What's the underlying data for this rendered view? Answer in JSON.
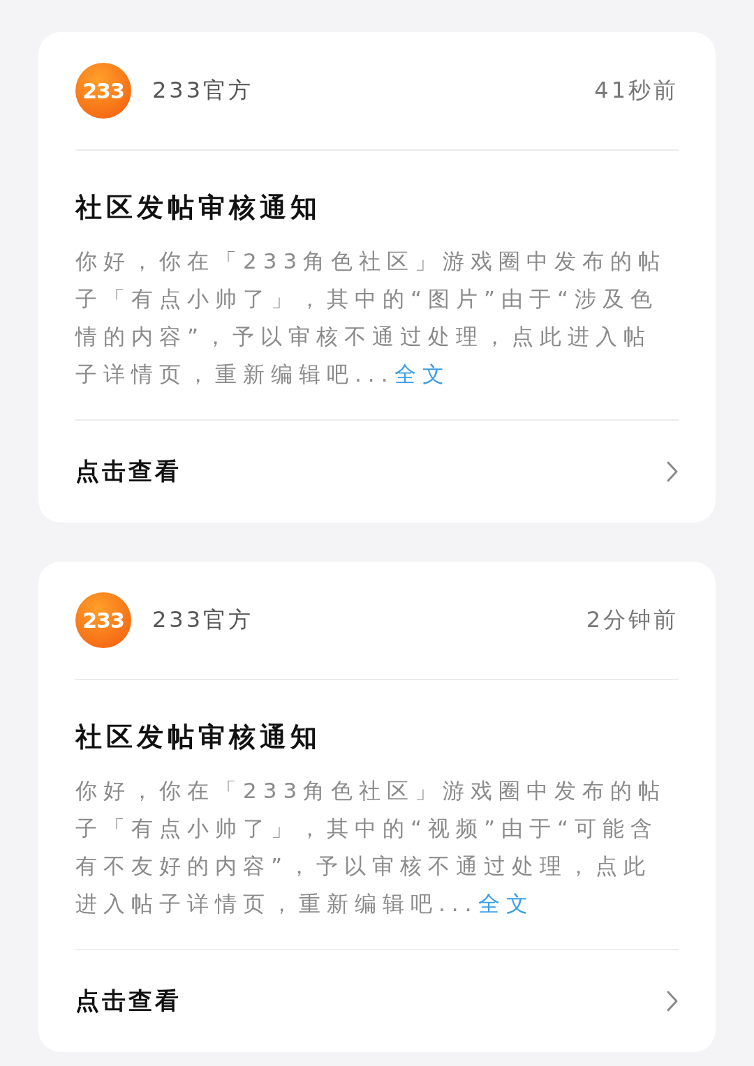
{
  "notifications": [
    {
      "sender": {
        "avatar_text": "233",
        "name": "233官方"
      },
      "time": "41秒前",
      "title": "社区发帖审核通知",
      "body": "你好，你在「233角色社区」游戏圈中发布的帖子「有点小帅了」，其中的“图片”由于“涉及色情的内容”，予以审核不通过处理，点此进入帖子详情页，重新编辑吧...",
      "more_link": "全文",
      "action": "点击查看"
    },
    {
      "sender": {
        "avatar_text": "233",
        "name": "233官方"
      },
      "time": "2分钟前",
      "title": "社区发帖审核通知",
      "body": "你好，你在「233角色社区」游戏圈中发布的帖子「有点小帅了」，其中的“视频”由于“可能含有不友好的内容”，予以审核不通过处理，点此进入帖子详情页，重新编辑吧...",
      "more_link": "全文",
      "action": "点击查看"
    }
  ]
}
